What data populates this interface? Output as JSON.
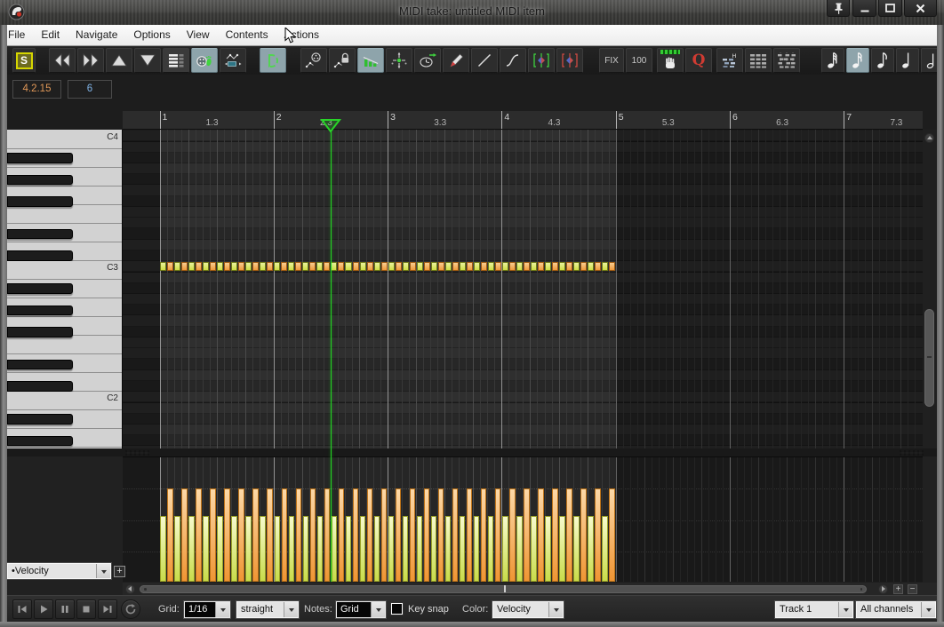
{
  "window": {
    "title": "MIDI take: untitled MIDI item"
  },
  "titlebar": {
    "icons": [
      "reaper-logo",
      "pin",
      "minimize",
      "maximize",
      "close"
    ]
  },
  "menu": {
    "items": [
      "File",
      "Edit",
      "Navigate",
      "Options",
      "View",
      "Contents",
      "Actions"
    ]
  },
  "toolbar": {
    "sync_label": "S",
    "fix_label": "FIX",
    "velocity_value": "100",
    "quantize_label": "Q"
  },
  "position": {
    "bar_beat": "4.2.15",
    "note_row": "6"
  },
  "ruler": {
    "labels": [
      "1",
      "1.3",
      "2",
      "2.3",
      "3",
      "3.3",
      "4",
      "4.3",
      "5",
      "5.3",
      "6",
      "6.3",
      "7",
      "7.3"
    ]
  },
  "piano": {
    "c_labels": [
      "C4",
      "C3",
      "C2"
    ]
  },
  "midi": {
    "pitch_row": "C3",
    "note_count": 64,
    "velocity_pattern": [
      68,
      96
    ],
    "velocity_max": 127,
    "playhead_label": "2.3",
    "playhead_measures_from_start": 1.5,
    "item_length_measures": 4,
    "visible_measures": 7
  },
  "colors": {
    "note_low": "#cede44",
    "note_low_light": "#eaf29e",
    "note_low_border": "#6f7a16",
    "note_high": "#ef9a3c",
    "note_high_light": "#f8cd92",
    "note_high_border": "#a05a10",
    "bar_low_top": "#f7facd",
    "bar_low_bottom": "#c8dc4a",
    "bar_low_border": "#9aa226",
    "bar_high_top": "#fcd9a8",
    "bar_high_bottom": "#ef9534",
    "bar_high_border": "#bf7418",
    "playhead": "#23d523"
  },
  "velocity_panel": {
    "selector_value": "•Velocity",
    "add_lane_label": "+"
  },
  "bottom": {
    "grid_label": "Grid:",
    "grid_value": "1/16",
    "swing_value": "straight",
    "notes_label": "Notes:",
    "notes_value": "Grid",
    "key_snap_label": "Key snap",
    "color_label": "Color:",
    "color_value": "Velocity",
    "track_value": "Track 1",
    "channel_value": "All channels"
  }
}
